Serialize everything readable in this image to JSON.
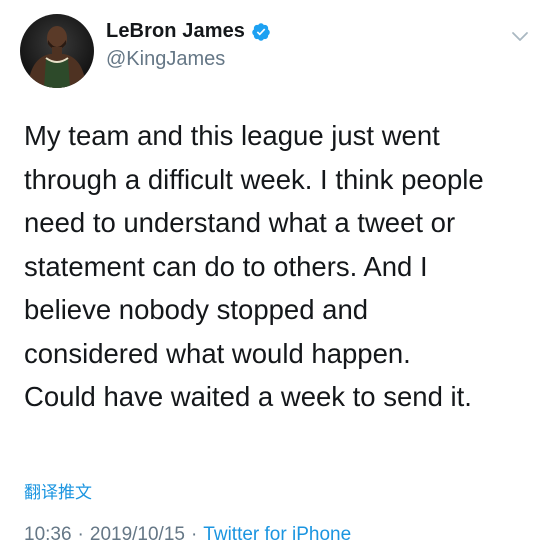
{
  "author": {
    "display_name": "LeBron James",
    "handle": "@KingJames",
    "verified": true
  },
  "tweet": {
    "lines": [
      "My team and this league just went",
      "through a difficult week.  I think people",
      "need to understand what a tweet or",
      "statement can do to others.  And I",
      "believe nobody stopped and",
      "considered what would happen.",
      "Could have waited a week to send it."
    ],
    "translate_label": "翻译推文"
  },
  "meta": {
    "time": "10:36",
    "sep1": "·",
    "date": "2019/10/15",
    "sep2": "·",
    "source": "Twitter for iPhone"
  },
  "colors": {
    "accent": "#1da1f2",
    "link": "#1b95e0",
    "secondary_text": "#657786",
    "primary_text": "#14171a"
  },
  "icons": {
    "verified": "verified-badge-icon",
    "menu": "chevron-down-icon"
  }
}
